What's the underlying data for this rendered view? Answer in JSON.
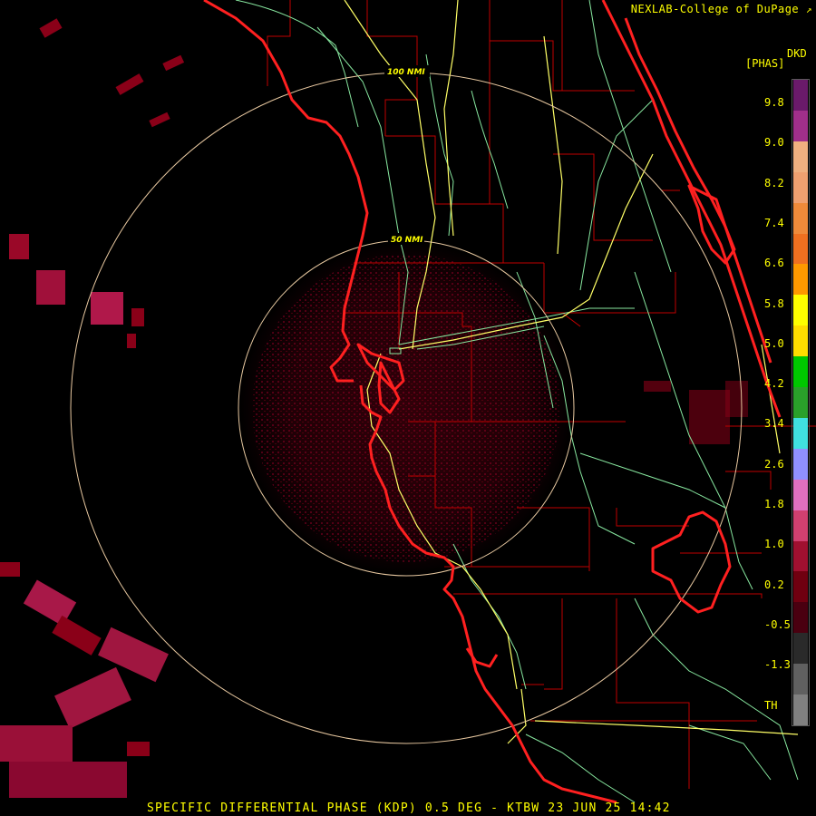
{
  "credit": "NEXLAB-College of DuPage",
  "credit_icon": "external-link-icon",
  "product_short": "DKD",
  "product_unit": "[PHAS]",
  "footer": "SPECIFIC DIFFERENTIAL PHASE (KDP) 0.5 DEG - KTBW 23 JUN 25 14:42",
  "range_rings": [
    {
      "label": "100 NMI"
    },
    {
      "label": "50 NMI"
    }
  ],
  "scale": {
    "labels": [
      "9.8",
      "9.0",
      "8.2",
      "7.4",
      "6.6",
      "5.8",
      "5.0",
      "4.2",
      "3.4",
      "2.6",
      "1.8",
      "1.0",
      "0.2",
      "-0.5",
      "-1.3",
      "TH"
    ],
    "colors": [
      "#6a1a6a",
      "#a02f8a",
      "#f0b080",
      "#f0a070",
      "#f08a3a",
      "#f07020",
      "#ff9900",
      "#ffff00",
      "#ffdd00",
      "#00c800",
      "#2aa02a",
      "#40e0e0",
      "#9090ff",
      "#e070c0",
      "#d04070",
      "#a01030",
      "#700010",
      "#4a0010",
      "#2a2a2a",
      "#606060",
      "#808080"
    ]
  },
  "colors": {
    "coastline": "#ff2020",
    "county": "#c00000",
    "highway": "#ffff66",
    "road": "#88e8a0",
    "ring": "#e8c8a0",
    "echo": "#8a0018",
    "text": "#ffff00"
  }
}
